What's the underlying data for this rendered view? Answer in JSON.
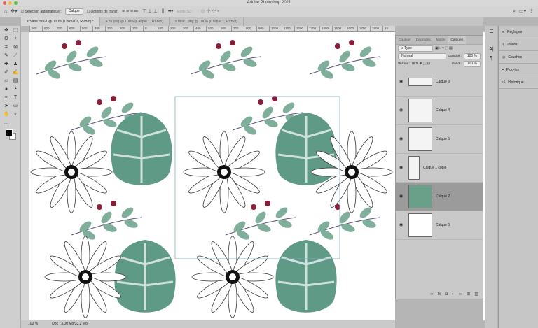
{
  "app": {
    "title": "Adobe Photoshop 2021"
  },
  "options": {
    "auto_select": "Sélection automatique :",
    "target": "Calque",
    "transform": "Options de transf.",
    "mode3d": "Mode 3D :"
  },
  "tabs": [
    "Sans titre-1 @ 100% (Calque 2, RVB/8) *",
    "p1.png @ 100% (Calque 1, RVB/8)",
    "fleur1.png @ 100% (Calque 1, RVB/8)"
  ],
  "ruler": [
    "900",
    "800",
    "700",
    "600",
    "500",
    "400",
    "300",
    "200",
    "100",
    "0",
    "100",
    "200",
    "300",
    "400",
    "500",
    "600",
    "700",
    "800",
    "900",
    "1000",
    "1100",
    "1200",
    "1300",
    "1400",
    "1500",
    "1600",
    "1700",
    "1800",
    "19"
  ],
  "status": {
    "zoom": "100 %",
    "doc": "Doc : 3,00 Mo/33,2 Mo"
  },
  "layers_panel": {
    "tabs": [
      "Couleur",
      "Dégradés",
      "Motifs",
      "Calques"
    ],
    "filter": "Type",
    "blend": "Normal",
    "opacity_label": "Opacité :",
    "opacity": "100 %",
    "lock_label": "Verrou :",
    "fill_label": "Fond :",
    "fill": "100 %",
    "layers": [
      {
        "name": "Calque 3"
      },
      {
        "name": "Calque 4"
      },
      {
        "name": "Calque 5"
      },
      {
        "name": "Calque 1 copie"
      },
      {
        "name": "Calque 2",
        "selected": true
      },
      {
        "name": "Calque 0"
      }
    ]
  },
  "dock": [
    "Réglages",
    "Tracés",
    "Couches",
    "Plug-ins",
    "Historique..."
  ]
}
